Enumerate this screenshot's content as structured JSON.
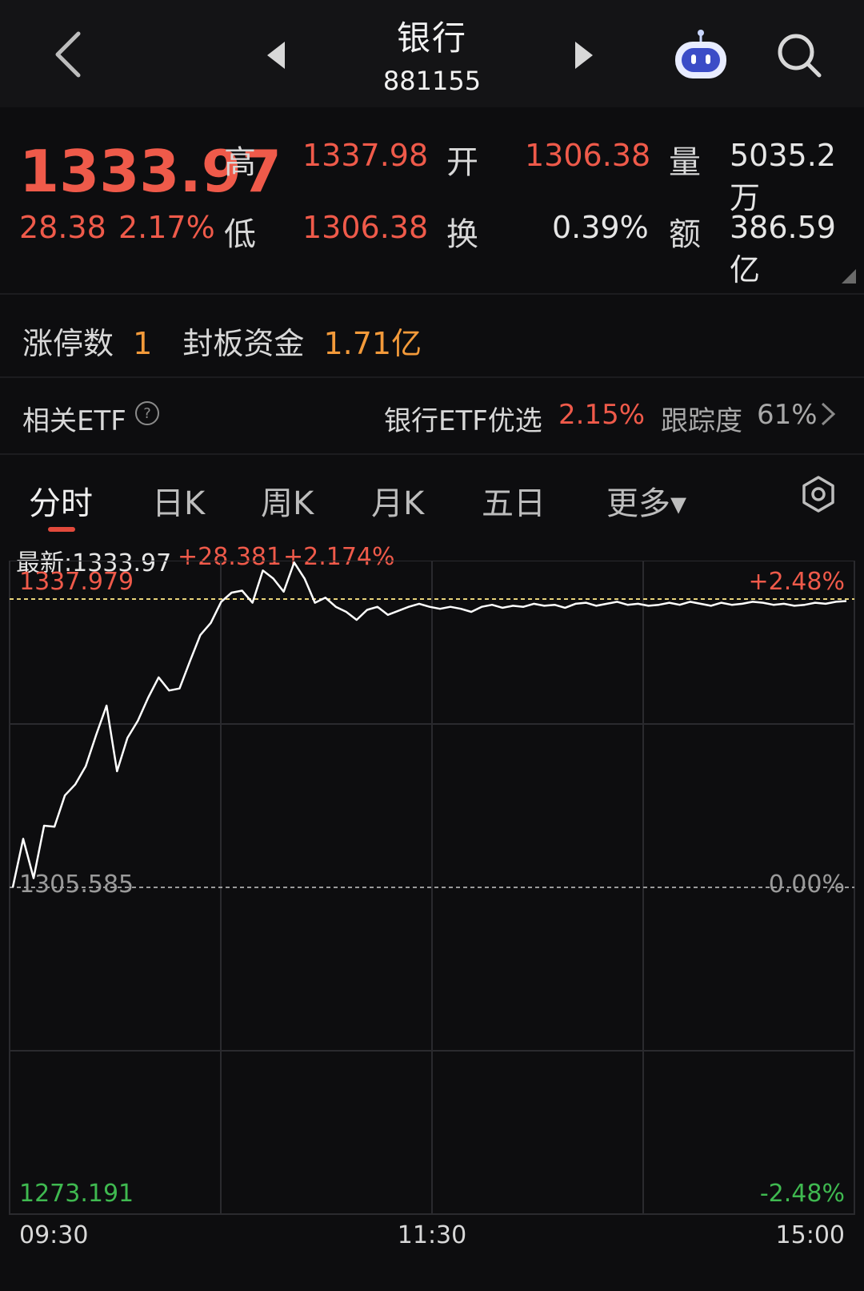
{
  "header": {
    "title": "银行",
    "code": "881155"
  },
  "quote": {
    "price": "1333.97",
    "change": "28.38",
    "change_pct": "2.17%",
    "high_label": "高",
    "high": "1337.98",
    "open_label": "开",
    "open": "1306.38",
    "volume_label": "量",
    "volume": "5035.2万",
    "low_label": "低",
    "low": "1306.38",
    "turnover_label": "换",
    "turnover": "0.39%",
    "amount_label": "额",
    "amount": "386.59亿"
  },
  "limit": {
    "count_label": "涨停数",
    "count": "1",
    "fund_label": "封板资金",
    "fund": "1.71亿"
  },
  "etf": {
    "label": "相关ETF",
    "name": "银行ETF优选",
    "pct": "2.15%",
    "track_label": "跟踪度",
    "track_value": "61%"
  },
  "tabs": [
    {
      "label": "分时",
      "active": true
    },
    {
      "label": "日K"
    },
    {
      "label": "周K"
    },
    {
      "label": "月K"
    },
    {
      "label": "五日"
    },
    {
      "label": "更多▾"
    }
  ],
  "latest": {
    "label": "最新:1333.97",
    "change": "+28.381",
    "pct": "+2.174%"
  },
  "colors": {
    "up": "#ef5a4a",
    "down": "#3fb950",
    "accent": "#f39a3a",
    "line": "#ffffff"
  },
  "chart_data": {
    "type": "line",
    "y_axis_labels": {
      "top_left": "1337.979",
      "top_right": "+2.48%",
      "mid_left": "1305.585",
      "mid_right": "0.00%",
      "bottom_left": "1273.191",
      "bottom_right": "-2.48%"
    },
    "x_tick_labels": [
      "09:30",
      "11:30",
      "15:00"
    ],
    "ylim": [
      1273.191,
      1337.979
    ],
    "prev_close": 1305.585,
    "high": 1337.979,
    "grid": true,
    "x": [
      0,
      1,
      2,
      3,
      4,
      5,
      6,
      7,
      8,
      9,
      10,
      11,
      12,
      13,
      14,
      15,
      16,
      17,
      18,
      19,
      20,
      21,
      22,
      23,
      24,
      25,
      26,
      27,
      28,
      29,
      30,
      31,
      32,
      33,
      34,
      35,
      36,
      37,
      38,
      39,
      40,
      41,
      42,
      43,
      44,
      45,
      46,
      47,
      48,
      49,
      50,
      51,
      52,
      53,
      54,
      55,
      56,
      57,
      58,
      59,
      60,
      61,
      62,
      63,
      64,
      65,
      66,
      67,
      68,
      69,
      70,
      71,
      72,
      73,
      74,
      75,
      76,
      77,
      78,
      79,
      80
    ],
    "y": [
      1305.6,
      1310.4,
      1306.5,
      1311.7,
      1311.6,
      1314.7,
      1315.8,
      1317.6,
      1320.7,
      1323.6,
      1317.1,
      1320.4,
      1322.1,
      1324.4,
      1326.4,
      1325.1,
      1325.3,
      1328.0,
      1330.6,
      1331.8,
      1333.9,
      1334.8,
      1335.0,
      1333.8,
      1337.0,
      1336.2,
      1334.9,
      1337.8,
      1336.2,
      1333.8,
      1334.3,
      1333.4,
      1332.9,
      1332.1,
      1333.1,
      1333.4,
      1332.6,
      1333.0,
      1333.4,
      1333.7,
      1333.4,
      1333.2,
      1333.4,
      1333.2,
      1332.9,
      1333.4,
      1333.6,
      1333.3,
      1333.5,
      1333.4,
      1333.7,
      1333.5,
      1333.6,
      1333.3,
      1333.7,
      1333.8,
      1333.5,
      1333.7,
      1333.9,
      1333.6,
      1333.7,
      1333.5,
      1333.6,
      1333.8,
      1333.6,
      1333.9,
      1333.7,
      1333.5,
      1333.8,
      1333.6,
      1333.7,
      1333.9,
      1333.8,
      1333.6,
      1333.7,
      1333.5,
      1333.6,
      1333.8,
      1333.7,
      1333.9,
      1333.97
    ]
  }
}
